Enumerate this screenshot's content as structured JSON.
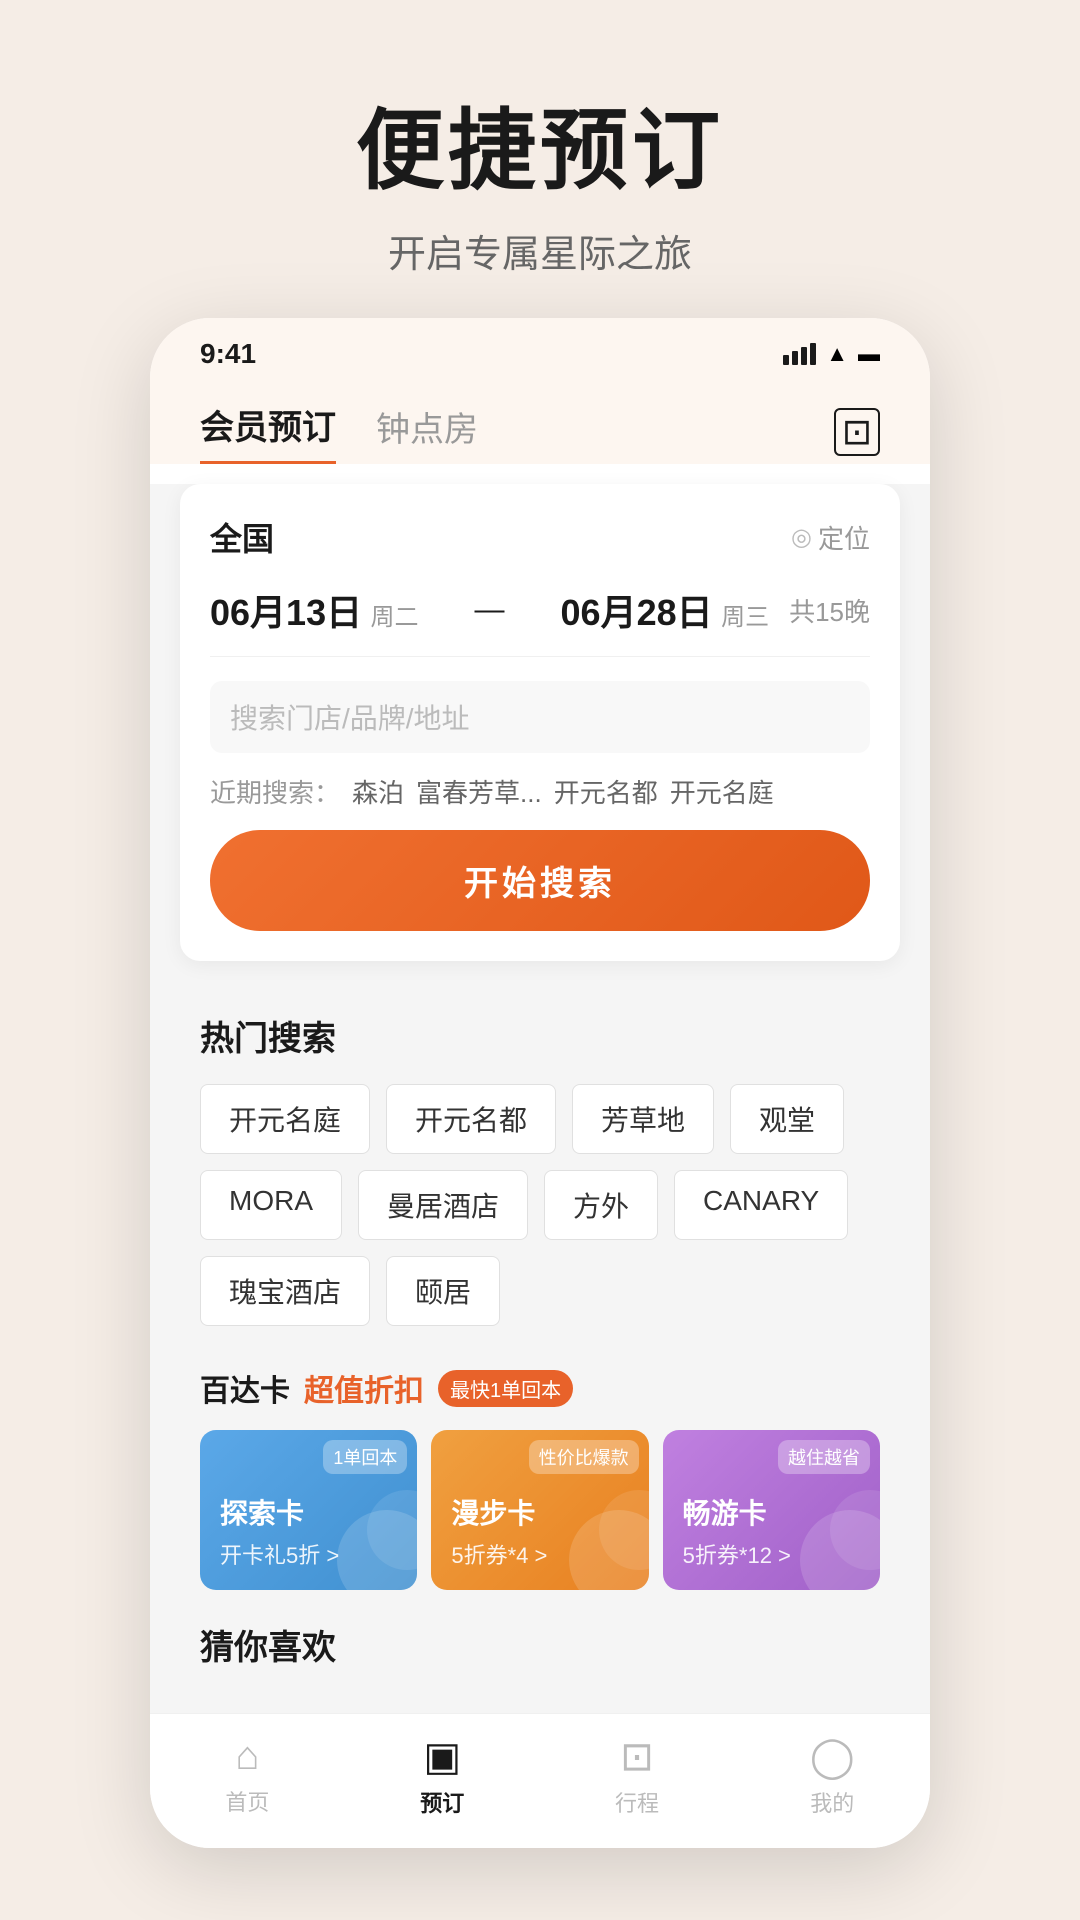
{
  "header": {
    "title": "便捷预订",
    "subtitle": "开启专属星际之旅"
  },
  "statusBar": {
    "time": "9:41"
  },
  "tabs": {
    "active": "会员预订",
    "inactive": "钟点房"
  },
  "searchCard": {
    "location": "全国",
    "locateLabel": "定位",
    "dateFrom": "06月13日",
    "dayFrom": "周二",
    "dateTo": "06月28日",
    "dayTo": "周三",
    "arrow": "—",
    "nights": "共15晚",
    "searchPlaceholder": "搜索门店/品牌/地址",
    "recentLabel": "近期搜索：",
    "recentItems": [
      "森泊",
      "富春芳草...",
      "开元名都",
      "开元名庭"
    ],
    "searchBtnLabel": "开始搜索"
  },
  "hotSearch": {
    "title": "热门搜索",
    "tags": [
      "开元名庭",
      "开元名都",
      "芳草地",
      "观堂",
      "MORA",
      "曼居酒店",
      "方外",
      "CANARY",
      "瑰宝酒店",
      "颐居"
    ]
  },
  "promoSection": {
    "titleMain": "百达卡",
    "titleHighlight": "超值折扣",
    "badge": "最快1单回本",
    "cards": [
      {
        "type": "blue",
        "badge": "1单回本",
        "name": "探索卡",
        "desc": "开卡礼5折 >"
      },
      {
        "type": "orange",
        "badge": "性价比爆款",
        "name": "漫步卡",
        "desc": "5折券*4 >"
      },
      {
        "type": "purple",
        "badge": "越住越省",
        "name": "畅游卡",
        "desc": "5折券*12 >"
      }
    ]
  },
  "guessSection": {
    "title": "猜你喜欢"
  },
  "bottomNav": {
    "items": [
      {
        "label": "首页",
        "icon": "home",
        "active": false
      },
      {
        "label": "预订",
        "icon": "book",
        "active": true
      },
      {
        "label": "行程",
        "icon": "bag",
        "active": false
      },
      {
        "label": "我的",
        "icon": "user",
        "active": false
      }
    ]
  }
}
